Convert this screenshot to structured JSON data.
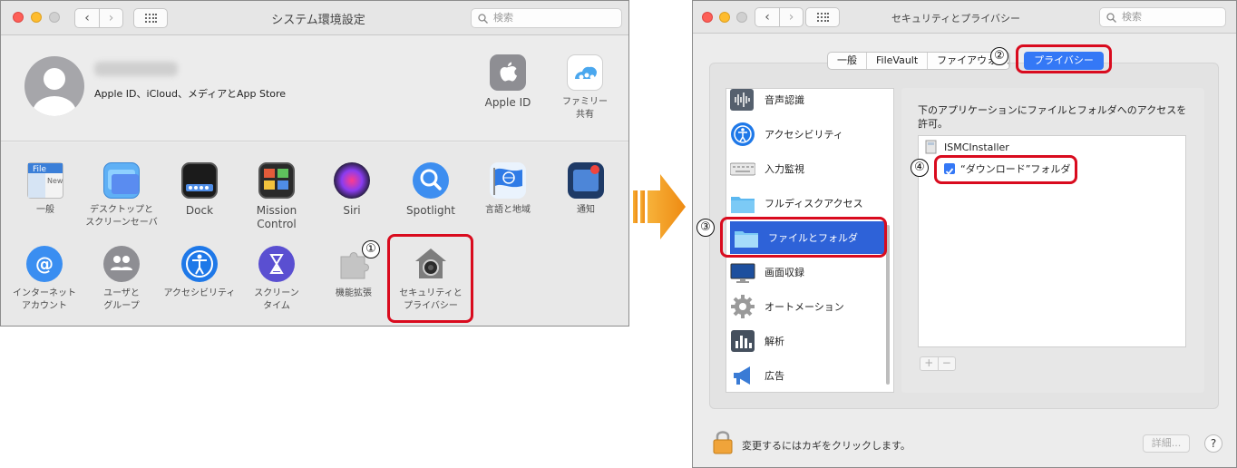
{
  "left_window": {
    "title": "システム環境設定",
    "search_placeholder": "検索",
    "account": {
      "subtitle": "Apple ID、iCloud、メディアとApp Store"
    },
    "top_right": [
      {
        "label": "Apple ID",
        "icon": "apple-icon"
      },
      {
        "label_line1": "ファミリー",
        "label_line2": "共有",
        "icon": "family-sharing-icon"
      }
    ],
    "row1": [
      {
        "label_line1": "一般",
        "label_line2": "",
        "icon": "general-icon"
      },
      {
        "label_line1": "デスクトップと",
        "label_line2": "スクリーンセーバ",
        "icon": "desktop-icon"
      },
      {
        "label_line1": "Dock",
        "label_line2": "",
        "icon": "dock-icon"
      },
      {
        "label_line1": "Mission",
        "label_line2": "Control",
        "icon": "mission-control-icon"
      },
      {
        "label_line1": "Siri",
        "label_line2": "",
        "icon": "siri-icon"
      },
      {
        "label_line1": "Spotlight",
        "label_line2": "",
        "icon": "spotlight-icon"
      },
      {
        "label_line1": "言語と地域",
        "label_line2": "",
        "icon": "language-region-icon"
      },
      {
        "label_line1": "通知",
        "label_line2": "",
        "icon": "notifications-icon"
      }
    ],
    "row2": [
      {
        "label_line1": "インターネット",
        "label_line2": "アカウント",
        "icon": "internet-accounts-icon"
      },
      {
        "label_line1": "ユーザと",
        "label_line2": "グループ",
        "icon": "users-groups-icon"
      },
      {
        "label_line1": "アクセシビリティ",
        "label_line2": "",
        "icon": "accessibility-icon"
      },
      {
        "label_line1": "スクリーン",
        "label_line2": "タイム",
        "icon": "screen-time-icon"
      },
      {
        "label_line1": "機能拡張",
        "label_line2": "",
        "icon": "extensions-icon"
      },
      {
        "label_line1": "セキュリティと",
        "label_line2": "プライバシー",
        "icon": "security-privacy-icon"
      }
    ]
  },
  "right_window": {
    "title": "セキュリティとプライバシー",
    "search_placeholder": "検索",
    "tabs": [
      "一般",
      "FileVault",
      "ファイアウォール"
    ],
    "selected_tab": "プライバシー",
    "categories": [
      {
        "label": "音声認識",
        "icon": "speech-recognition-icon"
      },
      {
        "label": "アクセシビリティ",
        "icon": "accessibility-icon"
      },
      {
        "label": "入力監視",
        "icon": "keyboard-icon"
      },
      {
        "label": "フルディスクアクセス",
        "icon": "folder-icon"
      },
      {
        "label": "ファイルとフォルダ",
        "icon": "folder-icon"
      },
      {
        "label": "画面収録",
        "icon": "display-icon"
      },
      {
        "label": "オートメーション",
        "icon": "gear-icon"
      },
      {
        "label": "解析",
        "icon": "chart-icon"
      },
      {
        "label": "広告",
        "icon": "megaphone-icon"
      }
    ],
    "selected_category": "ファイルとフォルダ",
    "description": "下のアプリケーションにファイルとフォルダへのアクセスを許可。",
    "app_name": "ISMCInstaller",
    "permission_label": "“ダウンロード”フォルダ",
    "permission_checked": true,
    "add_label": "+",
    "remove_label": "−",
    "lock_text": "変更するにはカギをクリックします。",
    "advanced_label": "詳細...",
    "help_label": "?"
  },
  "annotations": [
    "①",
    "②",
    "③",
    "④"
  ],
  "colors": {
    "highlight": "#d90b1e",
    "accent": "#3478f6",
    "arrow": "#f39a1e"
  }
}
